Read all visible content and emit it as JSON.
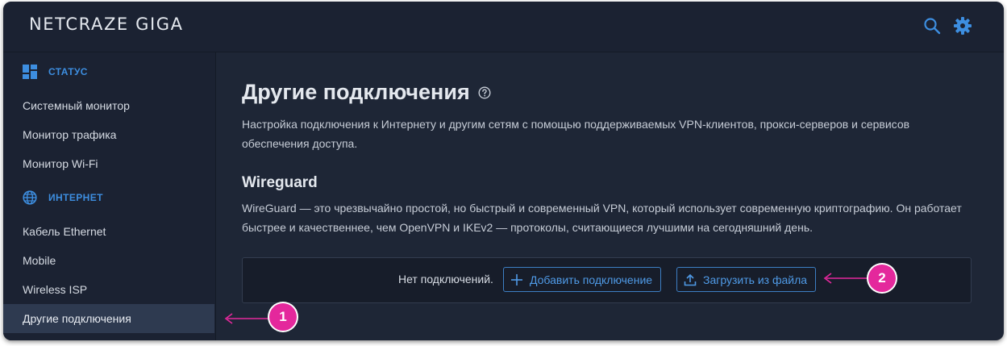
{
  "app": {
    "logo": "NETCRAZE GIGA",
    "search_icon": "search-icon",
    "settings_icon": "gear-icon",
    "accent_color": "#3d8ee0",
    "annotation_color": "#e4289c"
  },
  "sidebar": {
    "sections": [
      {
        "title": "СТАТУС",
        "icon": "dashboard-icon",
        "items": [
          "Системный монитор",
          "Монитор трафика",
          "Монитор Wi-Fi"
        ]
      },
      {
        "title": "ИНТЕРНЕТ",
        "icon": "globe-icon",
        "items": [
          "Кабель Ethernet",
          "Mobile",
          "Wireless ISP",
          "Другие подключения"
        ]
      }
    ],
    "active_item": "Другие подключения"
  },
  "main": {
    "title": "Другие подключения",
    "description": "Настройка подключения к Интернету и другим сетям с помощью поддерживаемых VPN-клиентов, прокси-серверов и сервисов обеспечения доступа.",
    "wireguard": {
      "title": "Wireguard",
      "description": "WireGuard — это чрезвычайно простой, но быстрый и современный VPN, который использует современную криптографию. Он работает быстрее и качественнее, чем OpenVPN и IKEv2 — протоколы, считающиеся лучшими на сегодняшний день.",
      "no_connections": "Нет подключений.",
      "add_button": "Добавить подключение",
      "upload_button": "Загрузить из файла"
    }
  },
  "annotations": [
    "1",
    "2"
  ]
}
